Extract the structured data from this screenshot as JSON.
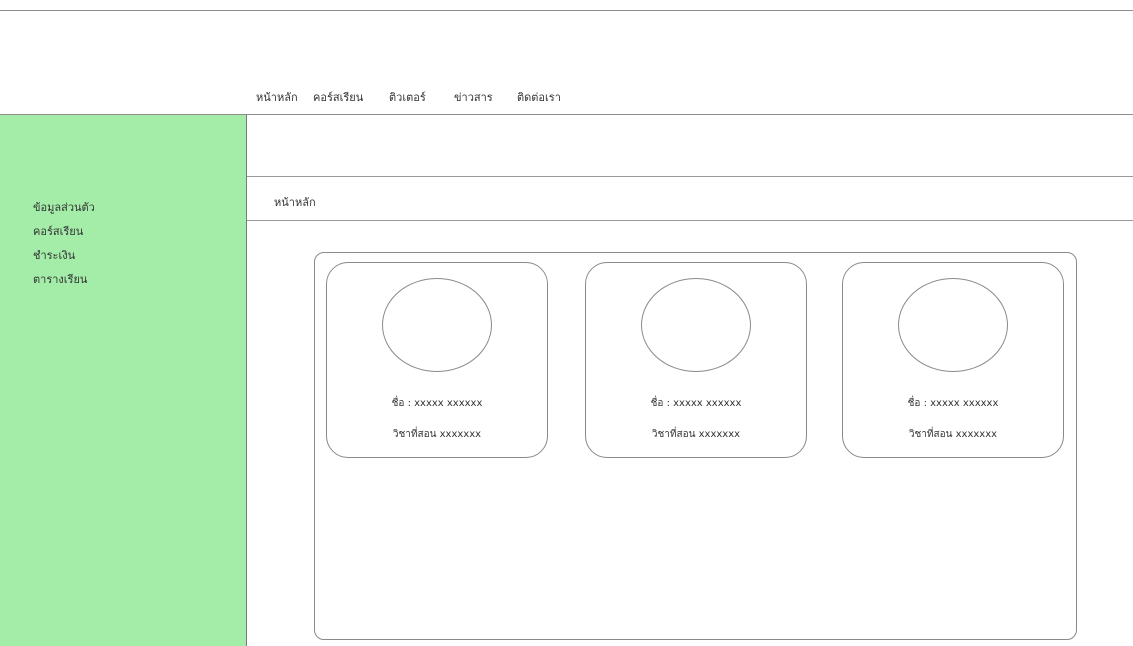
{
  "nav": {
    "items": [
      "หน้าหลัก",
      "คอร์สเรียน",
      "ติวเตอร์",
      "ข่าวสาร",
      "ติดต่อเรา"
    ]
  },
  "sidebar": {
    "items": [
      "ข้อมูลส่วนตัว",
      "คอร์สเรียน",
      "ชำระเงิน",
      "ตารางเรียน"
    ],
    "background_color": "#a3eda8"
  },
  "breadcrumb": "หน้าหลัก",
  "tutors": [
    {
      "name": "ชื่อ : xxxxx  xxxxxx",
      "subject": "วิชาที่สอน xxxxxxx"
    },
    {
      "name": "ชื่อ : xxxxx  xxxxxx",
      "subject": "วิชาที่สอน xxxxxxx"
    },
    {
      "name": "ชื่อ : xxxxx  xxxxxx",
      "subject": "วิชาที่สอน xxxxxxx"
    }
  ]
}
